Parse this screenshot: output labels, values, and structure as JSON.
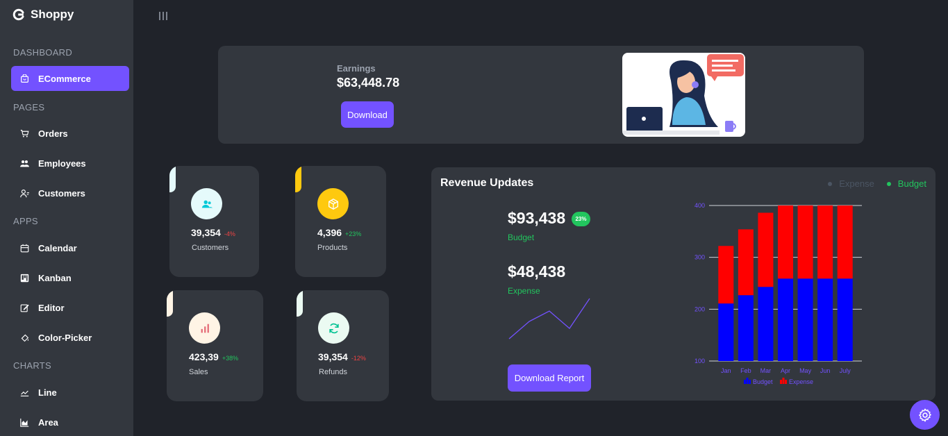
{
  "app": {
    "name": "Shoppy"
  },
  "sidebar": {
    "sections": [
      {
        "title": "DASHBOARD",
        "items": [
          {
            "label": "ECommerce",
            "icon": "shopping-bag-icon",
            "active": true
          }
        ]
      },
      {
        "title": "PAGES",
        "items": [
          {
            "label": "Orders",
            "icon": "cart-icon"
          },
          {
            "label": "Employees",
            "icon": "people-icon"
          },
          {
            "label": "Customers",
            "icon": "user-icon"
          }
        ]
      },
      {
        "title": "APPS",
        "items": [
          {
            "label": "Calendar",
            "icon": "calendar-icon"
          },
          {
            "label": "Kanban",
            "icon": "kanban-icon"
          },
          {
            "label": "Editor",
            "icon": "edit-icon"
          },
          {
            "label": "Color-Picker",
            "icon": "paint-bucket-icon"
          }
        ]
      },
      {
        "title": "CHARTS",
        "items": [
          {
            "label": "Line",
            "icon": "line-chart-icon"
          },
          {
            "label": "Area",
            "icon": "area-chart-icon"
          }
        ]
      }
    ]
  },
  "earnings": {
    "label": "Earnings",
    "value": "$63,448.78",
    "button": "Download"
  },
  "stats": [
    {
      "value": "39,354",
      "change": "-4%",
      "label": "Customers",
      "icon": "customers-icon",
      "color": "#03C9D7",
      "bg": "#E5FAFB"
    },
    {
      "value": "4,396",
      "change": "+23%",
      "label": "Products",
      "icon": "box-icon",
      "color": "#ffffff",
      "bg": "#FEC90F"
    },
    {
      "value": "423,39",
      "change": "+38%",
      "label": "Sales",
      "icon": "bar-chart-icon",
      "color": "#E46A76",
      "bg": "#FFF4E5"
    },
    {
      "value": "39,354",
      "change": "-12%",
      "label": "Refunds",
      "icon": "refresh-icon",
      "color": "#00C292",
      "bg": "#EBFAF2"
    }
  ],
  "revenue": {
    "title": "Revenue Updates",
    "legend": [
      {
        "label": "Expense",
        "color": "#4b5563"
      },
      {
        "label": "Budget",
        "color": "#22c55e"
      }
    ],
    "budget_value": "$93,438",
    "budget_badge": "23%",
    "budget_label": "Budget",
    "expense_value": "$48,438",
    "expense_label": "Expense",
    "button": "Download Report"
  },
  "chart_data": {
    "type": "bar",
    "stacked": true,
    "categories": [
      "Jan",
      "Feb",
      "Mar",
      "Apr",
      "May",
      "Jun",
      "July"
    ],
    "series": [
      {
        "name": "Budget",
        "color": "#0000ff",
        "values": [
          111,
          127,
          143,
          159,
          159,
          159,
          159
        ]
      },
      {
        "name": "Expense",
        "color": "#ff0000",
        "values": [
          111,
          127,
          143,
          159,
          159,
          159,
          159
        ]
      }
    ],
    "ylim": [
      100,
      400
    ],
    "yticks": [
      100,
      200,
      300,
      400
    ],
    "grid": true,
    "legend_position": "bottom"
  },
  "sparkline": {
    "values": [
      10,
      35,
      50,
      25,
      68
    ]
  },
  "settings": {
    "icon": "gear-icon"
  }
}
